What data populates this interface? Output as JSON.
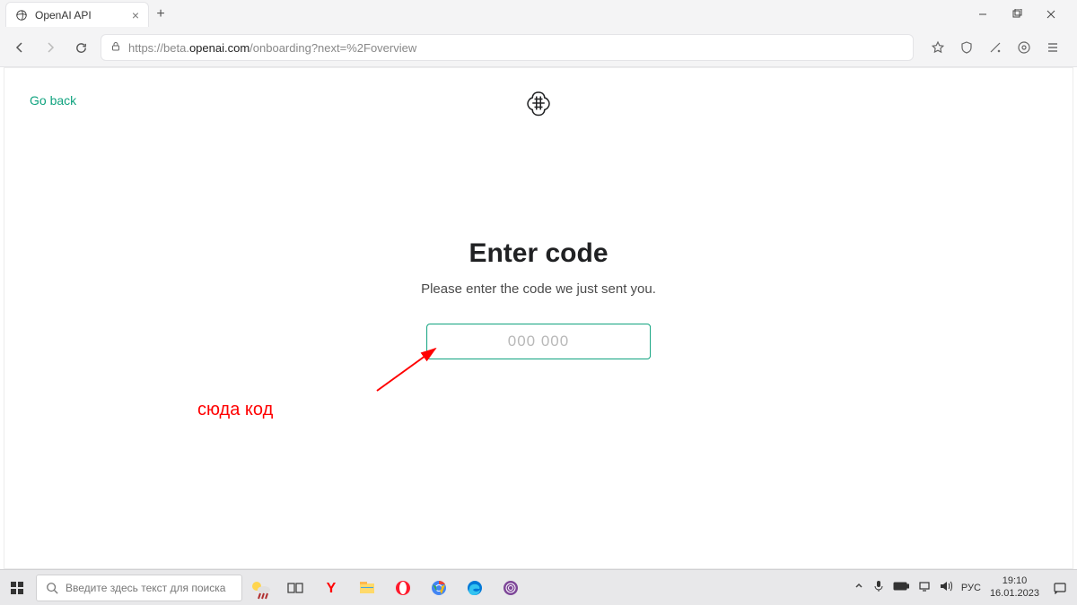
{
  "browser": {
    "tab_title": "OpenAI API",
    "url_prefix": "https://beta.",
    "url_domain": "openai.com",
    "url_path": "/onboarding?next=%2Foverview"
  },
  "page": {
    "go_back": "Go back",
    "heading": "Enter code",
    "subtext": "Please enter the code we just sent you.",
    "placeholder": "000 000"
  },
  "annotation": {
    "text": "сюда код"
  },
  "taskbar": {
    "search_placeholder": "Введите здесь текст для поиска",
    "lang": "РУС",
    "time": "19:10",
    "date": "16.01.2023"
  }
}
